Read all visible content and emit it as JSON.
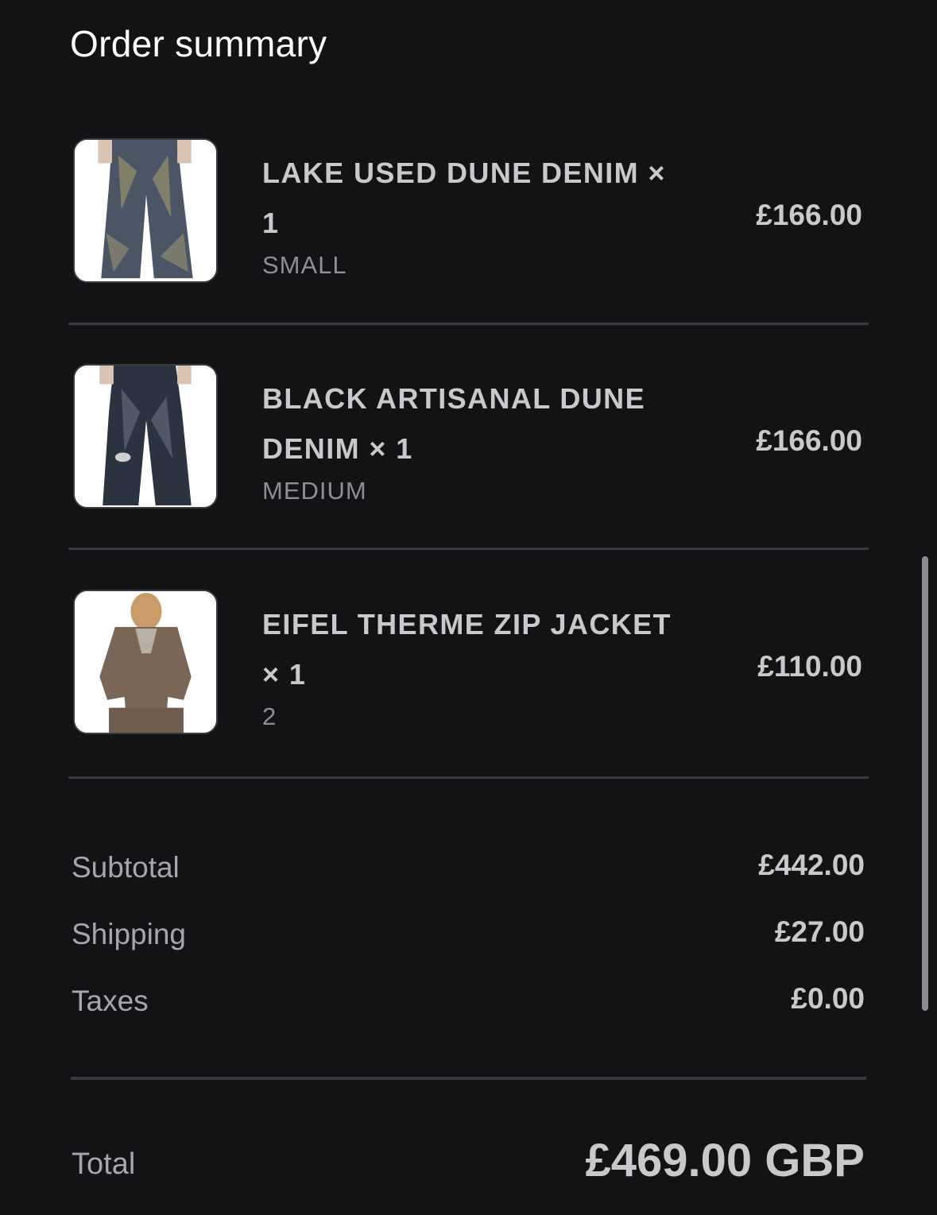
{
  "header": {
    "title": "Order summary"
  },
  "items": [
    {
      "name": "LAKE USED DUNE DENIM × 1",
      "variant": "SMALL",
      "price": "£166.00",
      "image": "jeans-photo"
    },
    {
      "name": "BLACK ARTISANAL DUNE DENIM × 1",
      "variant": "MEDIUM",
      "price": "£166.00",
      "image": "jeans-photo"
    },
    {
      "name": "EIFEL THERME ZIP JACKET × 1",
      "variant": "2",
      "price": "£110.00",
      "image": "jacket-photo"
    }
  ],
  "summary": {
    "subtotal_label": "Subtotal",
    "subtotal_value": "£442.00",
    "shipping_label": "Shipping",
    "shipping_value": "£27.00",
    "taxes_label": "Taxes",
    "taxes_value": "£0.00",
    "total_label": "Total",
    "total_value": "£469.00 GBP"
  },
  "colors": {
    "background": "#131316",
    "text_primary": "#c9c9cc",
    "text_secondary": "#8e8e93",
    "divider": "#3a3a3f"
  }
}
